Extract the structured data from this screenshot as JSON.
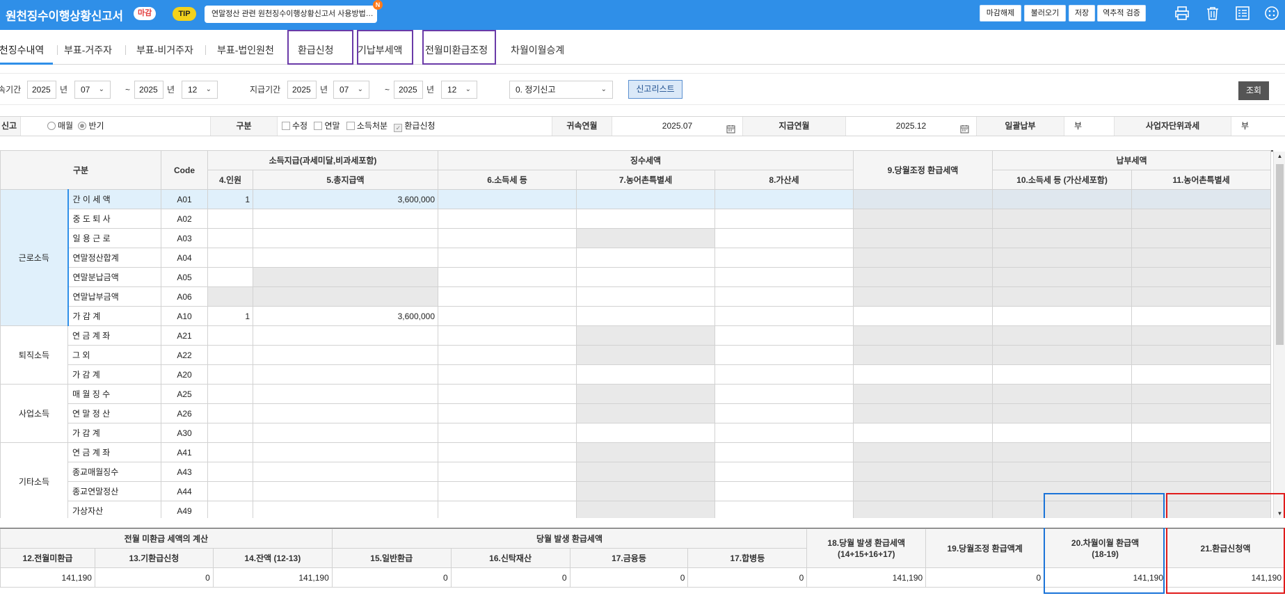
{
  "header": {
    "title": "원천징수이행상황신고서",
    "status_badge": "마감",
    "tip_label": "TIP",
    "tip_text": "연말정산 관련 원천징수이행상황신고서 사용방법…",
    "new_badge": "N",
    "buttons": [
      "마감해제",
      "불러오기",
      "저장",
      "역추적 검증"
    ],
    "icons": [
      "print-icon",
      "delete-icon",
      "checklist-icon",
      "menu-icon"
    ]
  },
  "tabs": [
    "원천징수내역",
    "부표-거주자",
    "부표-비거주자",
    "부표-법인원천",
    "환급신청",
    "기납부세액",
    "전월미환급조정",
    "차월이월승계"
  ],
  "filter": {
    "attr_label": "귀속기간",
    "attr_from_year": "2025",
    "year_unit": "년",
    "attr_from_month": "07",
    "tilde": "~",
    "attr_to_year": "2025",
    "attr_to_month": "12",
    "pay_label": "지급기간",
    "pay_from_year": "2025",
    "pay_from_month": "07",
    "pay_to_year": "2025",
    "pay_to_month": "12",
    "report_type": "0. 정기신고",
    "list_button": "신고리스트",
    "view_button": "조회"
  },
  "info": {
    "report_label": "신고",
    "monthly": "매월",
    "half": "반기",
    "kind_label": "구분",
    "opts": [
      "수정",
      "연말",
      "소득처분",
      "환급신청"
    ],
    "attr_month_label": "귀속연월",
    "attr_month": "2025.07",
    "pay_month_label": "지급연월",
    "pay_month": "2025.12",
    "lump_label": "일괄납부",
    "lump_value": "부",
    "biz_label": "사업자단위과세",
    "biz_value": "부"
  },
  "grid": {
    "h_kind": "구분",
    "h_code": "Code",
    "h_income": "소득지급(과세미달,비과세포함)",
    "h_withhold": "징수세액",
    "h_adjust": "9.당월조정 환급세액",
    "h_pay": "납부세액",
    "h_people": "4.인원",
    "h_total": "5.총지급액",
    "h_tax": "6.소득세 등",
    "h_rural": "7.농어촌특별세",
    "h_add": "8.가산세",
    "h_paytax": "10.소득세 등 (가산세포함)",
    "h_payrural": "11.농어촌특별세",
    "groups": [
      "근로소득",
      "퇴직소득",
      "사업소득",
      "기타소득"
    ],
    "rows": [
      {
        "sub": "간 이 세 액",
        "code": "A01",
        "people": "1",
        "total": "3,600,000"
      },
      {
        "sub": "중 도 퇴 사",
        "code": "A02",
        "people": "",
        "total": ""
      },
      {
        "sub": "일 용 근 로",
        "code": "A03",
        "people": "",
        "total": ""
      },
      {
        "sub": "연말정산합계",
        "code": "A04",
        "people": "",
        "total": ""
      },
      {
        "sub": "연말분납금액",
        "code": "A05",
        "people": "",
        "total": ""
      },
      {
        "sub": "연말납부금액",
        "code": "A06",
        "people": "",
        "total": ""
      },
      {
        "sub": "가 감 계",
        "code": "A10",
        "people": "1",
        "total": "3,600,000"
      },
      {
        "sub": "연 금 계 좌",
        "code": "A21",
        "people": "",
        "total": ""
      },
      {
        "sub": "그 외",
        "code": "A22",
        "people": "",
        "total": ""
      },
      {
        "sub": "가 감 계",
        "code": "A20",
        "people": "",
        "total": ""
      },
      {
        "sub": "매 월 징 수",
        "code": "A25",
        "people": "",
        "total": ""
      },
      {
        "sub": "연 말 정 산",
        "code": "A26",
        "people": "",
        "total": ""
      },
      {
        "sub": "가 감 계",
        "code": "A30",
        "people": "",
        "total": ""
      },
      {
        "sub": "연 금 계 좌",
        "code": "A41",
        "people": "",
        "total": ""
      },
      {
        "sub": "종교매월징수",
        "code": "A43",
        "people": "",
        "total": ""
      },
      {
        "sub": "종교연말정산",
        "code": "A44",
        "people": "",
        "total": ""
      },
      {
        "sub": "가상자산",
        "code": "A49",
        "people": "",
        "total": ""
      }
    ]
  },
  "bottom": {
    "h_prev": "전월 미환급 세액의 계산",
    "h_cur": "당월 발생 환급세액",
    "h_18": "18.당월 발생 환급세액",
    "h_18b": "(14+15+16+17)",
    "h_19": "19.당월조정 환급액계",
    "h_20": "20.차월이월 환급액",
    "h_20b": "(18-19)",
    "h_21": "21.환급신청액",
    "h_12": "12.전월미환급",
    "h_13": "13.기환급신청",
    "h_14": "14.잔액 (12-13)",
    "h_15": "15.일반환급",
    "h_16": "16.신탁재산",
    "h_17a": "17.금융등",
    "h_17b": "17.합병등",
    "values": [
      "141,190",
      "0",
      "141,190",
      "0",
      "0",
      "0",
      "0",
      "141,190",
      "0",
      "141,190",
      "141,190"
    ]
  }
}
